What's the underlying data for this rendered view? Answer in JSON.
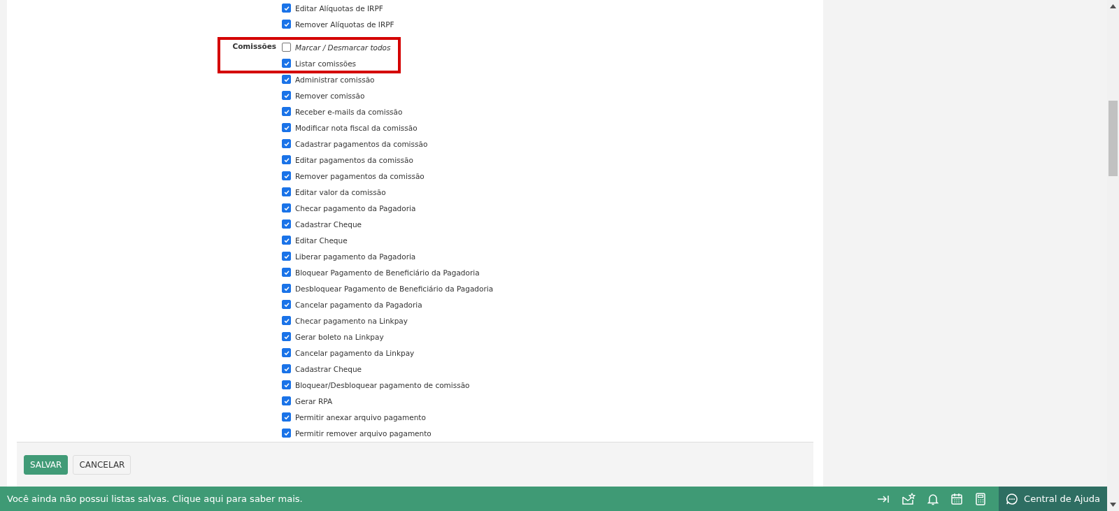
{
  "permission_groups": [
    {
      "items": [
        {
          "label": "Editar Alíquotas de IRPF",
          "checked": true
        },
        {
          "label": "Remover Alíquotas de IRPF",
          "checked": true
        }
      ]
    },
    {
      "label": "Comissões",
      "highlighted": true,
      "toggle_all": {
        "label": "Marcar / Desmarcar todos",
        "checked": false
      },
      "items": [
        {
          "label": "Listar comissões",
          "checked": true
        },
        {
          "label": "Administrar comissão",
          "checked": true
        },
        {
          "label": "Remover comissão",
          "checked": true
        },
        {
          "label": "Receber e-mails da comissão",
          "checked": true
        },
        {
          "label": "Modificar nota fiscal da comissão",
          "checked": true
        },
        {
          "label": "Cadastrar pagamentos da comissão",
          "checked": true
        },
        {
          "label": "Editar pagamentos da comissão",
          "checked": true
        },
        {
          "label": "Remover pagamentos da comissão",
          "checked": true
        },
        {
          "label": "Editar valor da comissão",
          "checked": true
        },
        {
          "label": "Checar pagamento da Pagadoria",
          "checked": true
        },
        {
          "label": "Cadastrar Cheque",
          "checked": true
        },
        {
          "label": "Editar Cheque",
          "checked": true
        },
        {
          "label": "Liberar pagamento da Pagadoria",
          "checked": true
        },
        {
          "label": "Bloquear Pagamento de Beneficiário da Pagadoria",
          "checked": true
        },
        {
          "label": "Desbloquear Pagamento de Beneficiário da Pagadoria",
          "checked": true
        },
        {
          "label": "Cancelar pagamento da Pagadoria",
          "checked": true
        },
        {
          "label": "Checar pagamento na Linkpay",
          "checked": true
        },
        {
          "label": "Gerar boleto na Linkpay",
          "checked": true
        },
        {
          "label": "Cancelar pagamento da Linkpay",
          "checked": true
        },
        {
          "label": "Cadastrar Cheque",
          "checked": true
        },
        {
          "label": "Bloquear/Desbloquear pagamento de comissão",
          "checked": true
        },
        {
          "label": "Gerar RPA",
          "checked": true
        },
        {
          "label": "Permitir anexar arquivo pagamento",
          "checked": true
        },
        {
          "label": "Permitir remover arquivo pagamento",
          "checked": true
        }
      ]
    }
  ],
  "form_buttons": [
    {
      "label": "SALVAR",
      "kind": "primary"
    },
    {
      "label": "CANCELAR",
      "kind": "secondary"
    }
  ],
  "status_bar": {
    "message": "Você ainda não possui listas salvas. Clique aqui para saber mais.",
    "help_button": "Central de Ajuda"
  }
}
